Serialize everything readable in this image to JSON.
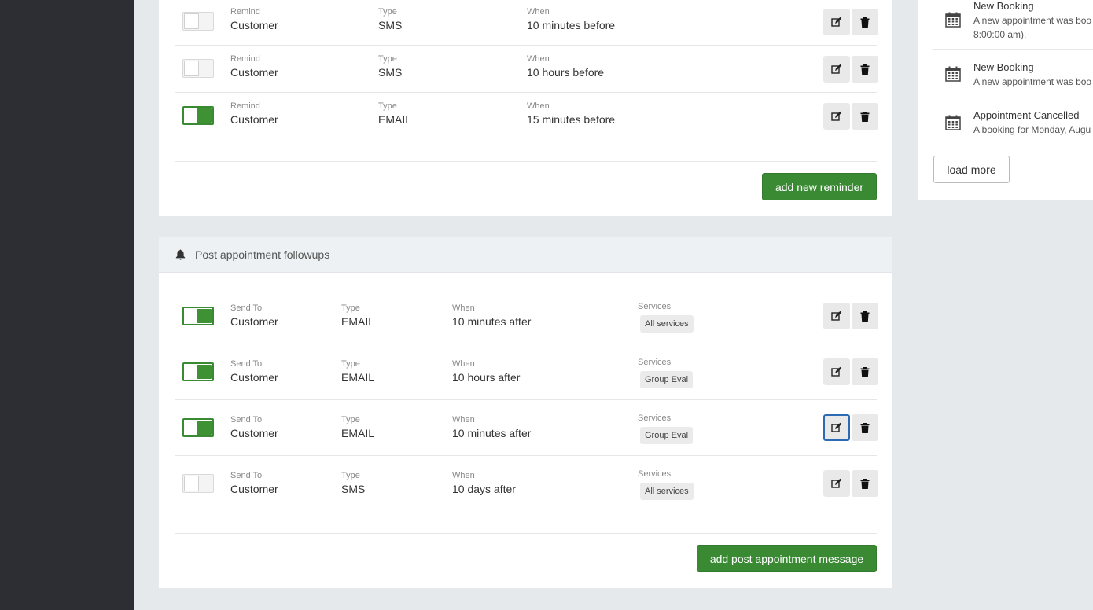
{
  "reminders": {
    "items": [
      {
        "enabled": false,
        "remind_label": "Remind",
        "remind": "Customer",
        "type_label": "Type",
        "type": "SMS",
        "when_label": "When",
        "when": "10 minutes before"
      },
      {
        "enabled": false,
        "remind_label": "Remind",
        "remind": "Customer",
        "type_label": "Type",
        "type": "SMS",
        "when_label": "When",
        "when": "10 hours before"
      },
      {
        "enabled": true,
        "remind_label": "Remind",
        "remind": "Customer",
        "type_label": "Type",
        "type": "EMAIL",
        "when_label": "When",
        "when": "15 minutes before"
      }
    ],
    "add_button": "add new reminder"
  },
  "followups": {
    "title": "Post appointment followups",
    "icon": "bell-icon",
    "items": [
      {
        "enabled": true,
        "send_to_label": "Send To",
        "send_to": "Customer",
        "type_label": "Type",
        "type": "EMAIL",
        "when_label": "When",
        "when": "10 minutes after",
        "services_label": "Services",
        "services": "All services"
      },
      {
        "enabled": true,
        "send_to_label": "Send To",
        "send_to": "Customer",
        "type_label": "Type",
        "type": "EMAIL",
        "when_label": "When",
        "when": "10 hours after",
        "services_label": "Services",
        "services": "Group Eval"
      },
      {
        "enabled": true,
        "send_to_label": "Send To",
        "send_to": "Customer",
        "type_label": "Type",
        "type": "EMAIL",
        "when_label": "When",
        "when": "10 minutes after",
        "services_label": "Services",
        "services": "Group Eval"
      },
      {
        "enabled": false,
        "send_to_label": "Send To",
        "send_to": "Customer",
        "type_label": "Type",
        "type": "SMS",
        "when_label": "When",
        "when": "10 days after",
        "services_label": "Services",
        "services": "All services"
      }
    ],
    "add_button": "add post appointment message"
  },
  "activity": {
    "items": [
      {
        "title": "New Booking",
        "desc_line1": "A new appointment was boo",
        "desc_line2": "8:00:00 am)."
      },
      {
        "title": "New Booking",
        "desc_line1": "A new appointment was boo"
      },
      {
        "title": "Appointment Cancelled",
        "desc_line1": "A booking for Monday, Augu"
      }
    ],
    "load_more": "load more"
  },
  "colors": {
    "accent_green": "#3a8a34",
    "sidebar": "#2c2e33",
    "focus_blue": "#2c6ab3"
  }
}
